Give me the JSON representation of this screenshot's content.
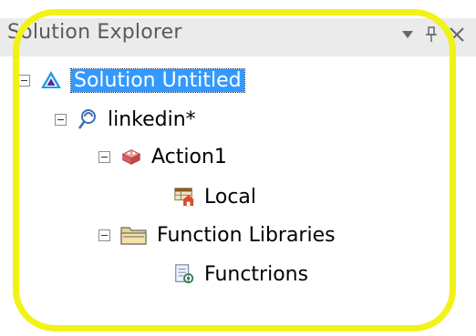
{
  "panel": {
    "title": "Solution Explorer",
    "controls": {
      "dropdown_icon": "dropdown-arrow-icon",
      "pin_icon": "pin-icon",
      "close_icon": "close-icon"
    }
  },
  "tree": {
    "solution": {
      "label": "Solution Untitled",
      "icon": "solution-icon",
      "selected": true
    },
    "test": {
      "label": "linkedin*",
      "icon": "test-icon"
    },
    "action": {
      "label": "Action1",
      "icon": "action-icon"
    },
    "local": {
      "label": "Local",
      "icon": "local-datasheet-icon"
    },
    "libraries": {
      "label": "Function Libraries",
      "icon": "folder-icon"
    },
    "library_file": {
      "label": "Functrions",
      "icon": "function-library-icon"
    }
  },
  "colors": {
    "selection": "#3399ff",
    "highlight_ring": "#f2f21a"
  }
}
